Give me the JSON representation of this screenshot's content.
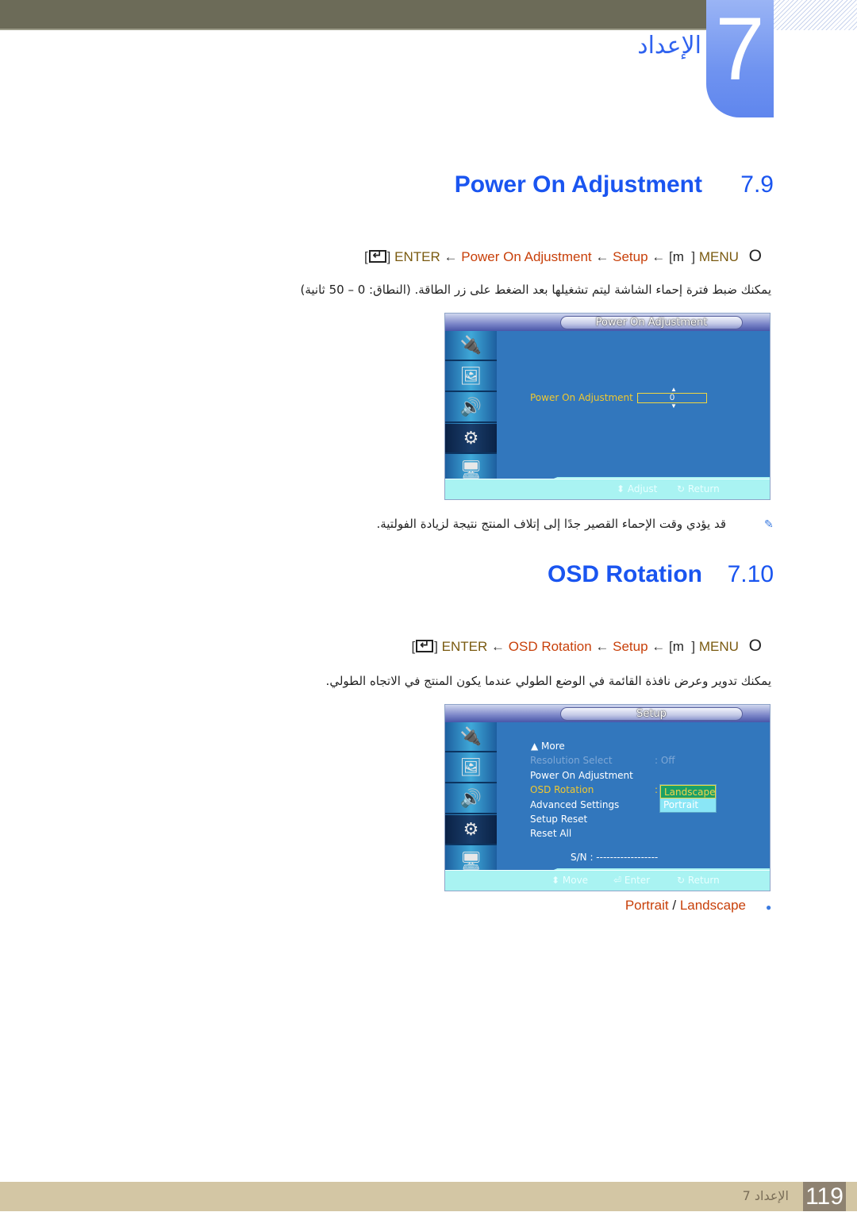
{
  "header": {
    "chapter_number": "7",
    "chapter_title": "الإعداد"
  },
  "sections": [
    {
      "number": "7.9",
      "title": "Power On Adjustment",
      "path": {
        "menu_key": "MENU",
        "menu_icon": "m",
        "step1": "Setup",
        "step2": "Power On Adjustment",
        "enter_key": "ENTER",
        "arrow": "←",
        "circle": "O"
      },
      "description": "يمكنك ضبط فترة إحماء الشاشة ليتم تشغيلها بعد الضغط على زر الطاقة. (النطاق: 0 – 50 ثانية)",
      "osd": {
        "header": "Power On Adjustment",
        "field_label": "Power On Adjustment :",
        "field_value": "0",
        "footer": {
          "adjust": "Adjust",
          "return": "Return"
        }
      },
      "note": "قد يؤدي وقت الإحماء القصير جدًا إلى إتلاف المنتج نتيجة لزيادة الفولتية."
    },
    {
      "number": "7.10",
      "title": "OSD Rotation",
      "path": {
        "menu_key": "MENU",
        "menu_icon": "m",
        "step1": "Setup",
        "step2": "OSD Rotation",
        "enter_key": "ENTER",
        "arrow": "←",
        "circle": "O"
      },
      "description": "يمكنك تدوير وعرض نافذة القائمة في الوضع الطولي عندما يكون المنتج في الاتجاه الطولي.",
      "osd": {
        "header": "Setup",
        "more": "▲ More",
        "items": [
          {
            "label": "Resolution Select",
            "value": ": Off",
            "state": "disabled"
          },
          {
            "label": "Power On Adjustment",
            "value": "",
            "state": "normal"
          },
          {
            "label": "OSD Rotation",
            "value": ":",
            "state": "selected"
          },
          {
            "label": "Advanced Settings",
            "value": "",
            "state": "normal"
          },
          {
            "label": "Setup Reset",
            "value": "",
            "state": "normal"
          },
          {
            "label": "Reset All",
            "value": "",
            "state": "normal"
          }
        ],
        "dropdown": [
          "Landscape",
          "Portrait"
        ],
        "dropdown_selected": "Landscape",
        "serial": "S/N : ------------------",
        "footer": {
          "move": "Move",
          "enter": "Enter",
          "return": "Return"
        }
      },
      "options": {
        "a": "Portrait",
        "sep": "/",
        "b": "Landscape"
      }
    }
  ],
  "sidebar_icons": [
    "input-icon",
    "picture-icon",
    "sound-icon",
    "setup-icon",
    "multi-control-icon"
  ],
  "footer": {
    "page_number": "119",
    "chapter_label": "الإعداد 7"
  }
}
